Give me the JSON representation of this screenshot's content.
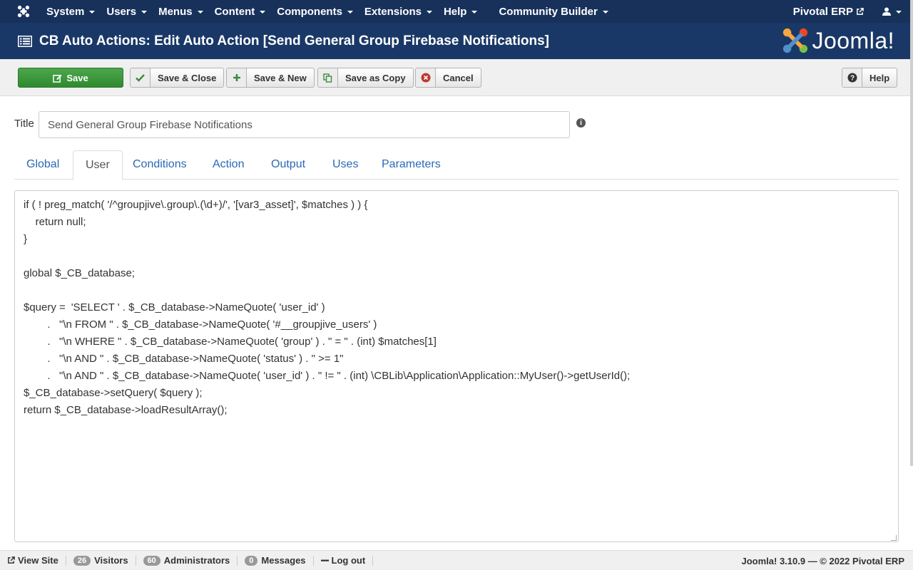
{
  "menu": {
    "items": [
      "System",
      "Users",
      "Menus",
      "Content",
      "Components",
      "Extensions",
      "Help",
      "Community Builder"
    ],
    "site_name": "Pivotal ERP"
  },
  "header": {
    "title": "CB Auto Actions: Edit Auto Action [Send General Group Firebase Notifications]",
    "brand": "Joomla!"
  },
  "toolbar": {
    "save": "Save",
    "save_close": "Save & Close",
    "save_new": "Save & New",
    "save_copy": "Save as Copy",
    "cancel": "Cancel",
    "help": "Help"
  },
  "form": {
    "title_label": "Title",
    "title_value": "Send General Group Firebase Notifications"
  },
  "tabs": [
    "Global",
    "User",
    "Conditions",
    "Action",
    "Output",
    "Uses",
    "Parameters"
  ],
  "active_tab": "User",
  "code": "if ( ! preg_match( '/^groupjive\\.group\\.(\\d+)/', '[var3_asset]', $matches ) ) {\n\treturn null;\n}\n\nglobal $_CB_database;\n\n$query\t=\t'SELECT ' . $_CB_database->NameQuote( 'user_id' )\n\t\t.\t\"\\n FROM \" . $_CB_database->NameQuote( '#__groupjive_users' )\n\t\t.\t\"\\n WHERE \" . $_CB_database->NameQuote( 'group' ) . \" = \" . (int) $matches[1]\n\t\t.\t\"\\n AND \" . $_CB_database->NameQuote( 'status' ) . \" >= 1\"\n\t\t.\t\"\\n AND \" . $_CB_database->NameQuote( 'user_id' ) . \" != \" . (int) \\CBLib\\Application\\Application::MyUser()->getUserId();\n$_CB_database->setQuery( $query );\nreturn $_CB_database->loadResultArray();",
  "footer": {
    "view_site": "View Site",
    "visitors_count": "26",
    "visitors": "Visitors",
    "admins_count": "60",
    "admins": "Administrators",
    "messages_count": "0",
    "messages": "Messages",
    "logout": "Log out",
    "version": "Joomla! 3.10.9 — © 2022 Pivotal ERP"
  },
  "colors": {
    "navbar": "#17315b",
    "header": "#1a3867",
    "save_green": "#3d9a3d",
    "link_blue": "#2a69b8"
  }
}
